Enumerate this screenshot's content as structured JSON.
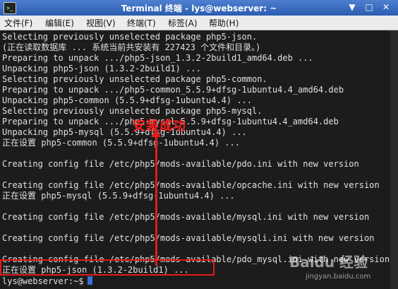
{
  "window": {
    "title": "Terminal 终端 - lys@webserver: ~",
    "app_icon_text": ">_",
    "controls": {
      "menu_glyph": "▼",
      "maximize_glyph": "□",
      "close_glyph": "✕"
    }
  },
  "menubar": {
    "items": [
      "文件(F)",
      "编辑(E)",
      "视图(V)",
      "终端(T)",
      "标签(A)",
      "帮助(H)"
    ]
  },
  "terminal": {
    "lines": [
      "Selecting previously unselected package php5-json.",
      "(正在读取数据库 ... 系统当前共安装有 227423 个文件和目录。)",
      "Preparing to unpack .../php5-json_1.3.2-2build1_amd64.deb ...",
      "Unpacking php5-json (1.3.2-2build1) ...",
      "Selecting previously unselected package php5-common.",
      "Preparing to unpack .../php5-common_5.5.9+dfsg-1ubuntu4.4_amd64.deb",
      "Unpacking php5-common (5.5.9+dfsg-1ubuntu4.4) ...",
      "Selecting previously unselected package php5-mysql.",
      "Preparing to unpack .../php5-mysql_5.5.9+dfsg-1ubuntu4.4_amd64.deb",
      "Unpacking php5-mysql (5.5.9+dfsg-1ubuntu4.4) ...",
      "正在设置 php5-common (5.5.9+dfsg-1ubuntu4.4) ...",
      "",
      "Creating config file /etc/php5/mods-available/pdo.ini with new version",
      "",
      "Creating config file /etc/php5/mods-available/opcache.ini with new version",
      "正在设置 php5-mysql (5.5.9+dfsg-1ubuntu4.4) ...",
      "",
      "Creating config file /etc/php5/mods-available/mysql.ini with new version",
      "",
      "Creating config file /etc/php5/mods-available/mysqli.ini with new version",
      "",
      "Creating config file /etc/php5/mods-available/pdo_mysql.ini with new version",
      "正在设置 php5-json (1.3.2-2build1) ..."
    ],
    "prompt": "lys@webserver:~$"
  },
  "annotation": {
    "callout_text": "安装成功",
    "color": "#e31a1a"
  },
  "watermark": {
    "logo": "Baidu 经验",
    "url": "jingyan.baidu.com"
  }
}
